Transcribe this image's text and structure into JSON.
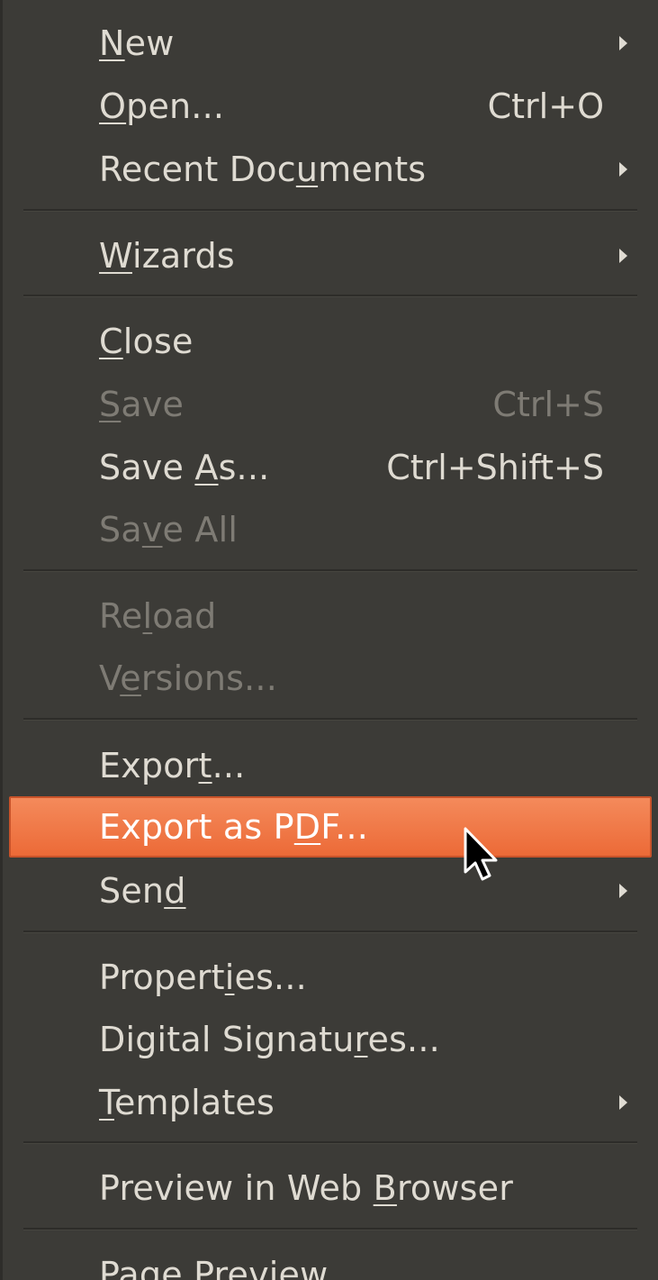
{
  "menu": {
    "items": [
      {
        "pre": "",
        "u": "N",
        "post": "ew",
        "shortcut": "",
        "submenu": true,
        "disabled": false
      },
      {
        "pre": "",
        "u": "O",
        "post": "pen...",
        "shortcut": "Ctrl+O",
        "submenu": false,
        "disabled": false
      },
      {
        "pre": "Recent Doc",
        "u": "u",
        "post": "ments",
        "shortcut": "",
        "submenu": true,
        "disabled": false
      },
      {
        "pre": "",
        "u": "W",
        "post": "izards",
        "shortcut": "",
        "submenu": true,
        "disabled": false
      },
      {
        "pre": "",
        "u": "C",
        "post": "lose",
        "shortcut": "",
        "submenu": false,
        "disabled": false
      },
      {
        "pre": "",
        "u": "S",
        "post": "ave",
        "shortcut": "Ctrl+S",
        "submenu": false,
        "disabled": true
      },
      {
        "pre": "Save ",
        "u": "A",
        "post": "s...",
        "shortcut": "Ctrl+Shift+S",
        "submenu": false,
        "disabled": false
      },
      {
        "pre": "Sa",
        "u": "v",
        "post": "e All",
        "shortcut": "",
        "submenu": false,
        "disabled": true
      },
      {
        "pre": "Re",
        "u": "l",
        "post": "oad",
        "shortcut": "",
        "submenu": false,
        "disabled": true
      },
      {
        "pre": "V",
        "u": "e",
        "post": "rsions...",
        "shortcut": "",
        "submenu": false,
        "disabled": true
      },
      {
        "pre": "Expor",
        "u": "t",
        "post": "...",
        "shortcut": "",
        "submenu": false,
        "disabled": false
      },
      {
        "pre": "Export as P",
        "u": "D",
        "post": "F...",
        "shortcut": "",
        "submenu": false,
        "disabled": false,
        "highlighted": true
      },
      {
        "pre": "Sen",
        "u": "d",
        "post": "",
        "shortcut": "",
        "submenu": true,
        "disabled": false
      },
      {
        "pre": "Propert",
        "u": "i",
        "post": "es...",
        "shortcut": "",
        "submenu": false,
        "disabled": false
      },
      {
        "pre": "Digital Signatu",
        "u": "r",
        "post": "es...",
        "shortcut": "",
        "submenu": false,
        "disabled": false
      },
      {
        "pre": "",
        "u": "T",
        "post": "emplates",
        "shortcut": "",
        "submenu": true,
        "disabled": false
      },
      {
        "pre": "Preview in Web ",
        "u": "B",
        "post": "rowser",
        "shortcut": "",
        "submenu": false,
        "disabled": false
      },
      {
        "pre": "Page Preview",
        "u": "",
        "post": "",
        "shortcut": "",
        "submenu": false,
        "disabled": false
      }
    ]
  },
  "colors": {
    "menu_bg": "#3c3b37",
    "text": "#dfdbd2",
    "disabled_text": "#7e7b74",
    "highlight": "#f07746",
    "highlight_border": "#c9532a"
  },
  "icons": {
    "submenu_arrow": "submenu-arrow-icon",
    "cursor": "mouse-pointer-icon"
  }
}
